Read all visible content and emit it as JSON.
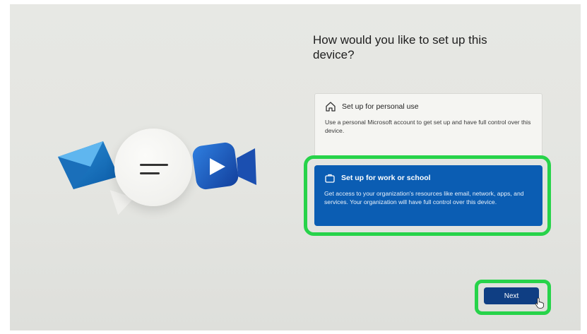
{
  "page": {
    "title": "How would you like to set up this device?"
  },
  "options": [
    {
      "title": "Set up for personal use",
      "description": "Use a personal Microsoft account to get set up and have full control over this device.",
      "icon": "home-icon",
      "selected": false
    },
    {
      "title": "Set up for work or school",
      "description": "Get access to your organization's resources like email, network, apps, and services. Your organization will have full control over this device.",
      "icon": "briefcase-icon",
      "selected": true
    }
  ],
  "footer": {
    "next_label": "Next"
  },
  "colors": {
    "selected_card": "#0b5db3",
    "next_button": "#0f3e83",
    "highlight": "#27d34a",
    "background": "#e5e6e2"
  }
}
